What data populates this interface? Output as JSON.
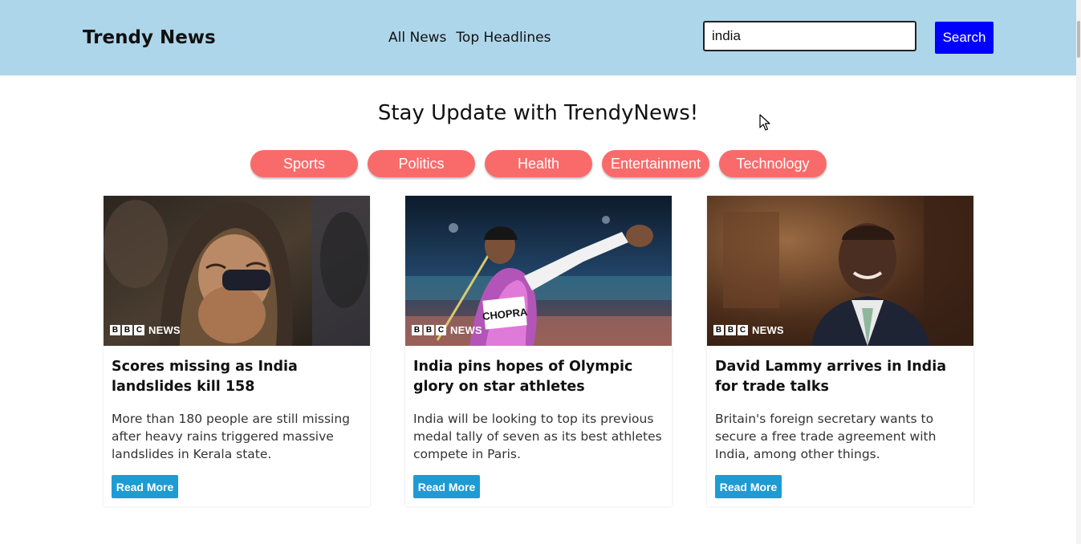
{
  "header": {
    "brand": "Trendy News",
    "nav": [
      "All News",
      "Top Headlines"
    ],
    "search_value": "india",
    "search_button": "Search"
  },
  "tagline": "Stay Update with TrendyNews!",
  "categories": [
    "Sports",
    "Politics",
    "Health",
    "Entertainment",
    "Technology"
  ],
  "source_logo": {
    "letters": [
      "B",
      "B",
      "C"
    ],
    "label": "NEWS"
  },
  "articles": [
    {
      "title": "Scores missing as India landslides kill 158",
      "description": "More than 180 people are still missing after heavy rains triggered massive landslides in Kerala state.",
      "button": "Read More",
      "image_subject": "grieving-woman"
    },
    {
      "title": "India pins hopes of Olympic glory on star athletes",
      "description": "India will be looking to top its previous medal tally of seven as its best athletes compete in Paris.",
      "button": "Read More",
      "image_subject": "javelin-thrower",
      "bib_text": "CHOPRA"
    },
    {
      "title": "David Lammy arrives in India for trade talks",
      "description": "Britain's foreign secretary wants to secure a free trade agreement with India, among other things.",
      "button": "Read More",
      "image_subject": "man-in-suit"
    }
  ],
  "colors": {
    "header_bg": "#aed6ea",
    "search_button": "#0000ff",
    "pill": "#f96b6b",
    "read_more": "#1e9bd3"
  }
}
